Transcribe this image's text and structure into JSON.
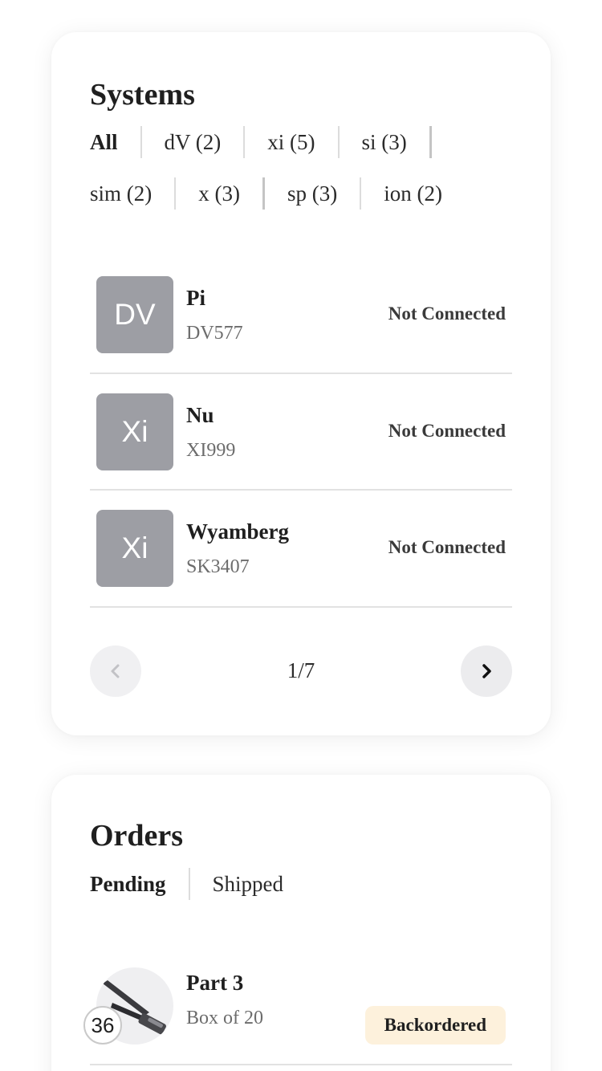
{
  "systems": {
    "title": "Systems",
    "filters_row1": [
      {
        "label": "All",
        "active": true
      },
      {
        "label": "dV (2)"
      },
      {
        "label": "xi (5)"
      },
      {
        "label": "si (3)"
      }
    ],
    "filters_row2": [
      {
        "label": "sim (2)"
      },
      {
        "label": "x (3)"
      },
      {
        "label": "sp (3)"
      },
      {
        "label": "ion (2)"
      }
    ],
    "items": [
      {
        "avatar": "DV",
        "name": "Pi",
        "code": "DV577",
        "status": "Not Connected"
      },
      {
        "avatar": "Xi",
        "name": "Nu",
        "code": "XI999",
        "status": "Not Connected"
      },
      {
        "avatar": "Xi",
        "name": "Wyamberg",
        "code": "SK3407",
        "status": "Not Connected"
      }
    ],
    "pagination": {
      "label": "1/7",
      "prev_icon": "chevron-left-icon",
      "next_icon": "chevron-right-icon"
    }
  },
  "orders": {
    "title": "Orders",
    "tabs": [
      {
        "label": "Pending",
        "active": true
      },
      {
        "label": "Shipped"
      }
    ],
    "items": [
      {
        "name": "Part 3",
        "pack": "Box of 20",
        "quantity": "36",
        "status": "Backordered",
        "thumb_icon": "stapler-instrument-icon"
      }
    ]
  },
  "colors": {
    "avatar_bg": "#9d9ea4",
    "status_pill_bg": "#fdf1dc",
    "divider": "#e2e2e2"
  }
}
